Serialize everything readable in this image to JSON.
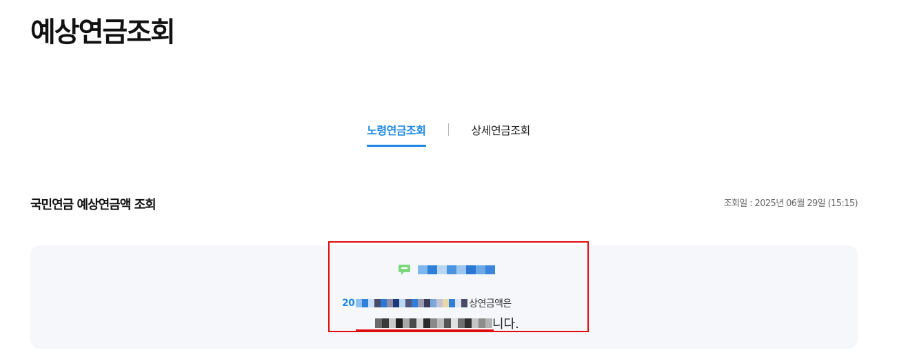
{
  "page": {
    "title": "예상연금조회"
  },
  "tabs": [
    {
      "label": "노령연금조회",
      "active": true
    },
    {
      "label": "상세연금조회",
      "active": false
    }
  ],
  "section": {
    "title": "국민연금 예상연금액 조회",
    "query_date": "조회일 : 2025년 06월 29일 (15:15)"
  },
  "result": {
    "icon": "chat-bubble-icon",
    "year_prefix": "20",
    "desc_suffix": "상연금액은",
    "amount_suffix": "니다."
  },
  "colors": {
    "accent": "#1e88e5",
    "highlight": "#e00b0b",
    "panel_bg": "#f5f7fa",
    "icon_green": "#7dd87d"
  }
}
